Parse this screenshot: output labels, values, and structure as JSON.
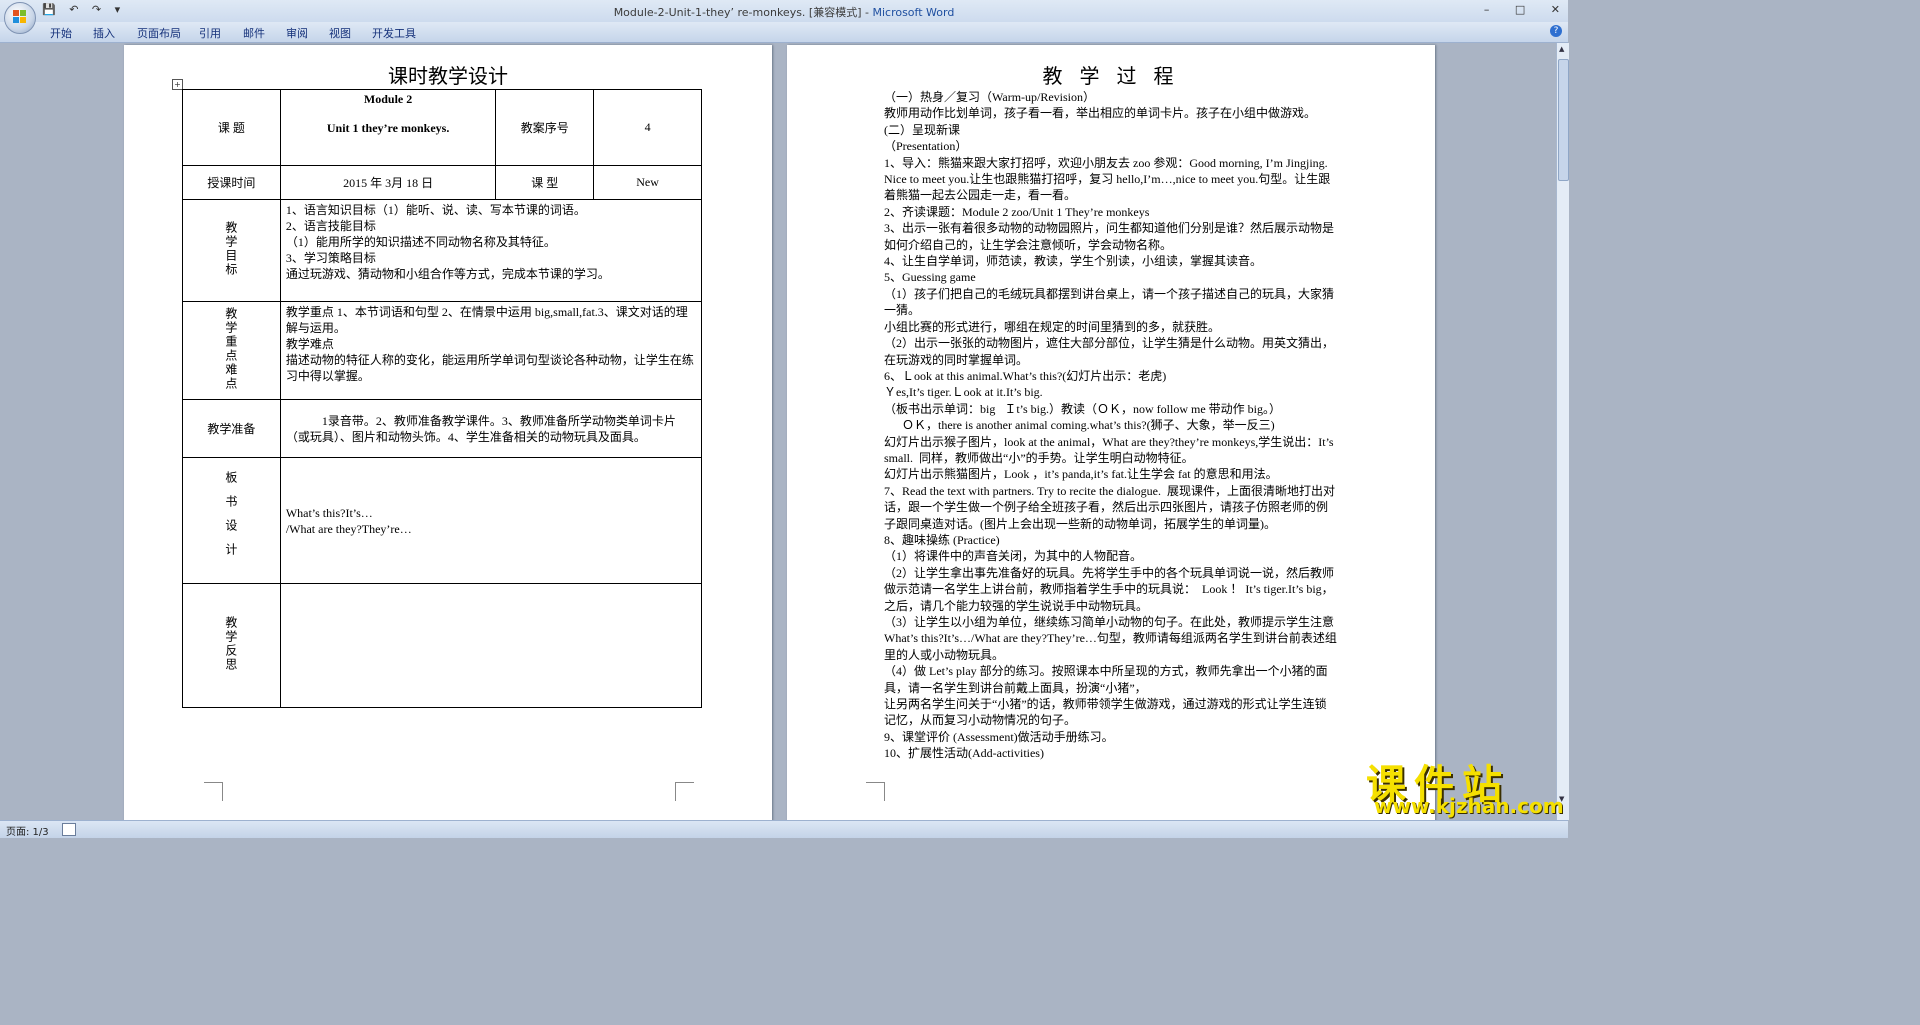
{
  "window": {
    "title_doc": "Module-2-Unit-1-they’  re-monkeys. [兼容模式] - ",
    "title_app": "Microsoft Word",
    "controls": [
      "–",
      "□",
      "✕"
    ]
  },
  "ribbon": {
    "tabs": [
      "开始",
      "插入",
      "页面布局",
      "引用",
      "邮件",
      "审阅",
      "视图",
      "开发工具"
    ]
  },
  "status": {
    "page": "页面: 1/3"
  },
  "page1": {
    "title": "课时教学设计",
    "table": {
      "topic_label": "课  题",
      "topic_line1": "Module 2",
      "topic_line2": "Unit 1 they’re monkeys.",
      "seq_label": "教案序号",
      "seq_value": "4",
      "time_label": "授课时间",
      "time_value": "2015 年    3月 18  日",
      "type_label": "课  型",
      "type_value": "New",
      "goals_label": "教学目标",
      "goals": [
        "1、语言知识目标（1）能听、说、读、写本节课的词语。",
        "2、语言技能目标",
        "（1）能用所学的知识描述不同动物名称及其特征。",
        "3、学习策略目标",
        "通过玩游戏、猜动物和小组合作等方式，完成本节课的学习。"
      ],
      "keypoints_label": "教学重点难点",
      "keypoints": [
        "教学重点  1、本节词语和句型  2、在情景中运用  big,small,fat.3、课文对话的理解与运用。",
        "教学难点",
        "描述动物的特征人称的变化，能运用所学单词句型谈论各种动物，让学生在练习中得以掌握。"
      ],
      "prep_label": "教学准备",
      "prep": "1录音带。2、教师准备教学课件。3、教师准备所学动物类单词卡片（或玩具）、图片和动物头饰。4、学生准备相关的动物玩具及面具。",
      "board_label": "板书设计",
      "board": [
        "What’s this?It’s…",
        "/What are they?They’re…"
      ],
      "reflect_label": "教学反思"
    }
  },
  "page2": {
    "title": "教 学 过 程",
    "lines": [
      "（一）热身／复习（Warm-up/Revision）",
      "教师用动作比划单词，孩子看一看，举出相应的单词卡片。孩子在小组中做游戏。",
      "(二）呈现新课",
      "（Presentation）",
      "1、导入：熊猫来跟大家打招呼，欢迎小朋友去 zoo 参观：Good morning, I’m Jingjing. Nice to meet you.让生也跟熊猫打招呼，复习 hello,I’m…,nice to meet you.句型。让生跟着熊猫一起去公园走一走，看一看。",
      "2、齐读课题：Module 2 zoo/Unit 1 They’re monkeys",
      "3、出示一张有着很多动物的动物园照片，问生都知道他们分别是谁？然后展示动物是如何介绍自己的，让生学会注意倾听，学会动物名称。",
      "4、让生自学单词，师范读，教读，学生个别读，小组读，掌握其读音。",
      "5、Guessing game",
      "（1）孩子们把自己的毛绒玩具都摆到讲台桌上，请一个孩子描述自己的玩具，大家猜一猜。",
      "小组比赛的形式进行，哪组在规定的时间里猜到的多，就获胜。",
      "（2）出示一张张的动物图片，遮住大部分部位，让学生猜是什么动物。用英文猜出，在玩游戏的同时掌握单词。",
      "6、Ｌook at this animal.What’s this?(幻灯片出示：老虎)",
      "Ｙes,It’s tiger.Ｌook at it.It’s big.",
      "（板书出示单词：big   Ｉt’s big.）教读（ＯＫ，now follow me 带动作 big。）",
      "      ＯＫ，there is another animal coming.what’s this?(狮子、大象，举一反三)",
      "幻灯片出示猴子图片，look at the animal，What are they?they’re monkeys,学生说出：It’s small.  同样，教师做出“小”的手势。让学生明白动物特征。",
      "幻灯片出示熊猫图片，Look ，it’s panda,it’s fat.让生学会 fat 的意思和用法。",
      "7、Read the text with partners. Try to recite the dialogue.  展现课件，上面很清晰地打出对话，跟一个学生做一个例子给全班孩子看，然后出示四张图片，请孩子仿照老师的例子跟同桌造对话。(图片上会出现一些新的动物单词，拓展学生的单词量)。",
      "8、趣味操练 (Practice)",
      "（1）将课件中的声音关闭，为其中的人物配音。",
      "（2）让学生拿出事先准备好的玩具。先将学生手中的各个玩具单词说一说，然后教师做示范请一名学生上讲台前，教师指着学生手中的玩具说：  Look ！ It’s tiger.It’s big，之后，请几个能力较强的学生说说手中动物玩具。",
      "（3）让学生以小组为单位，继续练习简单小动物的句子。在此处，教师提示学生注意 What’s this?It’s…/What are they?They’re…句型，教师请每组派两名学生到讲台前表述组里的人或小动物玩具。",
      "（4）做 Let’s play 部分的练习。按照课本中所呈现的方式，教师先拿出一个小猪的面具，请一名学生到讲台前戴上面具，扮演“小猪”，",
      "让另两名学生问关于“小猪”的话，教师带领学生做游戏，通过游戏的形式让学生连锁记忆，从而复习小动物情况的句子。",
      "9、课堂评价 (Assessment)做活动手册练习。",
      "10、扩展性活动(Add-activities)"
    ]
  },
  "watermark": {
    "text": "课件站",
    "url": "www.kjzhan.com"
  }
}
